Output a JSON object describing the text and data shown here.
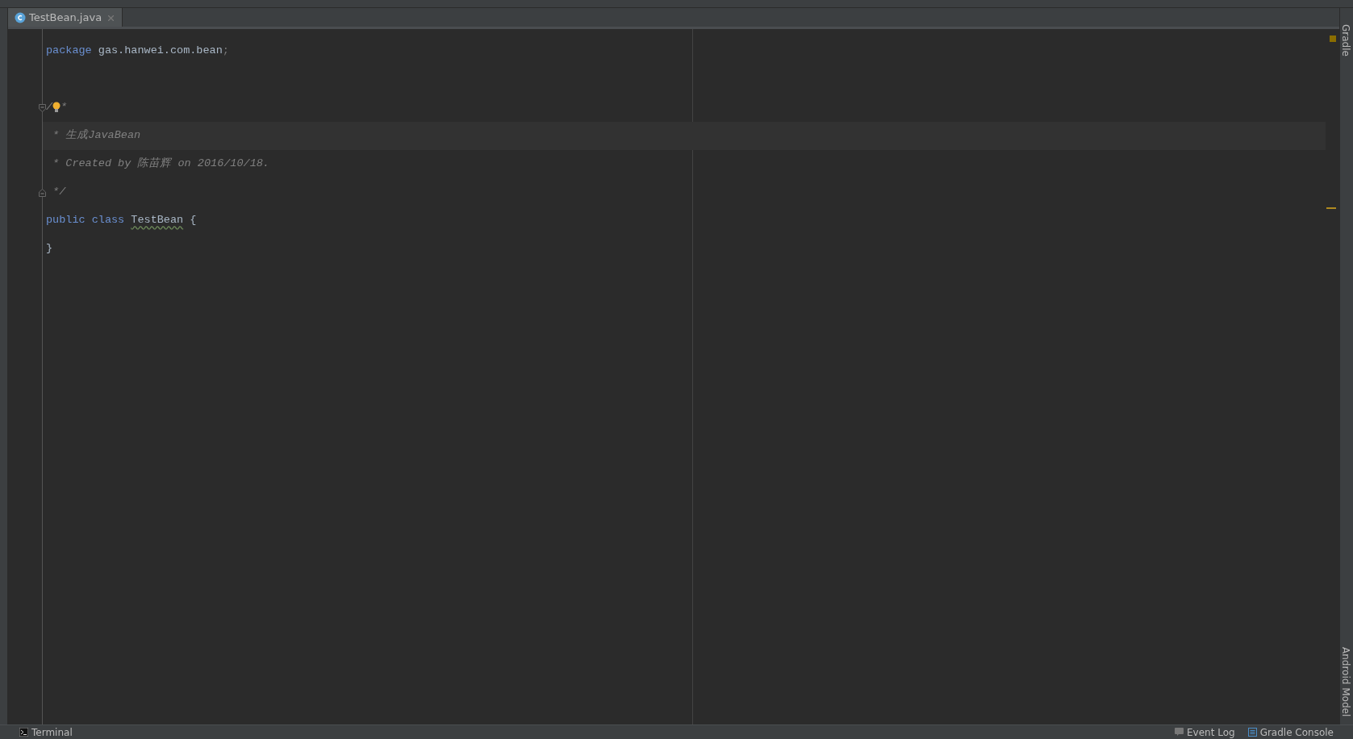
{
  "tabs": [
    {
      "label": "TestBean.java",
      "selected": true,
      "closable": true
    }
  ],
  "editor": {
    "lines": [
      {
        "current": false,
        "tokens": [
          {
            "kind": "keyword",
            "text": "package"
          },
          {
            "kind": "plain",
            "text": " gas.hanwei.com.bean"
          },
          {
            "kind": "dim",
            "text": ";"
          }
        ]
      },
      {
        "current": false
      },
      {
        "kind": "fold_start",
        "current": false,
        "tokens": [
          {
            "kind": "comment",
            "text": "/"
          },
          {
            "kind": "bulb"
          },
          {
            "kind": "comment",
            "text": "*"
          }
        ]
      },
      {
        "current": true,
        "tokens": [
          {
            "kind": "comment",
            "text": " * 生成JavaBean"
          }
        ]
      },
      {
        "current": false,
        "tokens": [
          {
            "kind": "comment",
            "text": " * Created by 陈苗辉 on 2016/10/18."
          }
        ]
      },
      {
        "kind": "fold_end",
        "current": false,
        "tokens": [
          {
            "kind": "comment",
            "text": " */"
          }
        ]
      },
      {
        "current": false,
        "tokens": [
          {
            "kind": "keyword",
            "text": "public"
          },
          {
            "kind": "keyword",
            "text": " class "
          },
          {
            "kind": "warning",
            "text": "TestBean"
          },
          {
            "kind": "plain",
            "text": " {"
          }
        ]
      },
      {
        "current": false,
        "tokens": [
          {
            "kind": "plain",
            "text": "}"
          }
        ]
      }
    ]
  },
  "right_toolbar": [
    "Gradle",
    "Android Model"
  ],
  "bottom_toolbar": {
    "left": [
      {
        "label": "Terminal",
        "kind": "terminal"
      }
    ],
    "right": [
      {
        "label": "Event Log",
        "kind": "log"
      },
      {
        "label": "Gradle Console",
        "kind": "console"
      }
    ]
  }
}
